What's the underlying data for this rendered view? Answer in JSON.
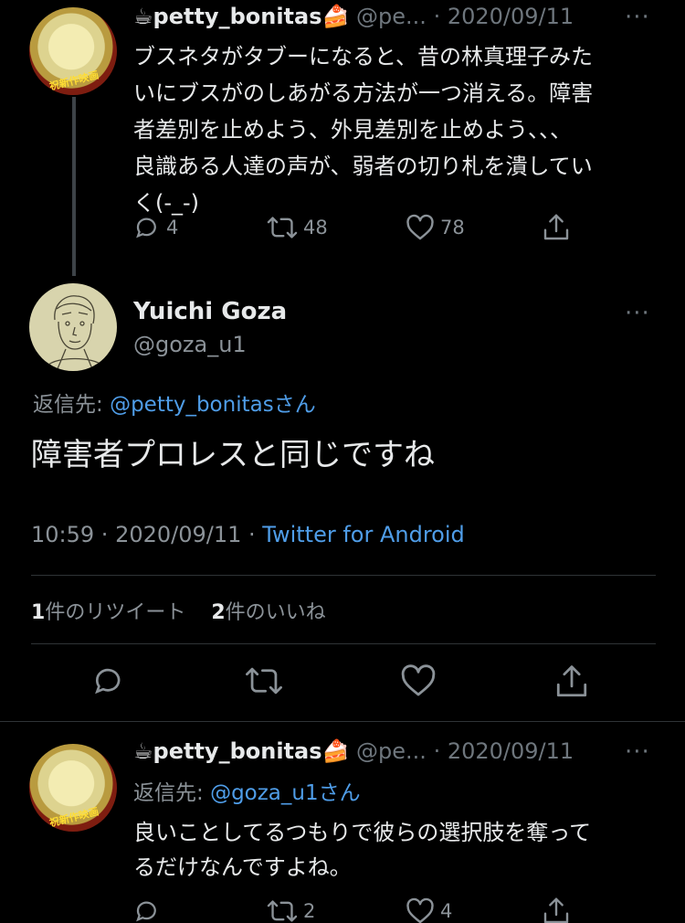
{
  "tweet1": {
    "display_name": "☕petty_bonitas🍰",
    "handle": "@pe...",
    "separator": "·",
    "date": "2020/09/11",
    "avatar_label": "祝新作映画",
    "text_lines": [
      "ブスネタがタブーになると、昔の林真理子みた",
      "いにブスがのしあがる方法が一つ消える。障害",
      "者差別を止めよう、外見差別を止めよう、、、",
      "良識ある人達の声が、弱者の切り札を潰してい",
      "く(-_-)"
    ],
    "replies": "4",
    "retweets": "48",
    "likes": "78"
  },
  "main_tweet": {
    "display_name": "Yuichi Goza",
    "handle": "@goza_u1",
    "reply_prefix": "返信先: ",
    "reply_to": "@petty_bonitasさん",
    "text": "障害者プロレスと同じですね",
    "time": "10:59",
    "sep1": " · ",
    "date": "2020/09/11",
    "sep2": " · ",
    "client": "Twitter for Android",
    "retweet_count": "1",
    "retweet_label": "件のリツイート",
    "like_count": "2",
    "like_label": "件のいいね"
  },
  "tweet3": {
    "display_name": "☕petty_bonitas🍰",
    "handle": "@pe...",
    "separator": "·",
    "date": "2020/09/11",
    "avatar_label": "祝新作映画",
    "reply_prefix": "返信先: ",
    "reply_to": "@goza_u1さん",
    "text_lines": [
      "良いことしてるつもりで彼らの選択肢を奪って",
      "るだけなんですよね。"
    ],
    "replies": "",
    "retweets": "2",
    "likes": "4"
  },
  "more_glyph": "···",
  "colors": {
    "background": "#000000",
    "text": "#e7e9ea",
    "muted": "#8b9298",
    "link": "#4f9de8",
    "divider": "#2f3336"
  },
  "icons": [
    "reply-icon",
    "retweet-icon",
    "like-icon",
    "share-icon",
    "more-icon"
  ]
}
